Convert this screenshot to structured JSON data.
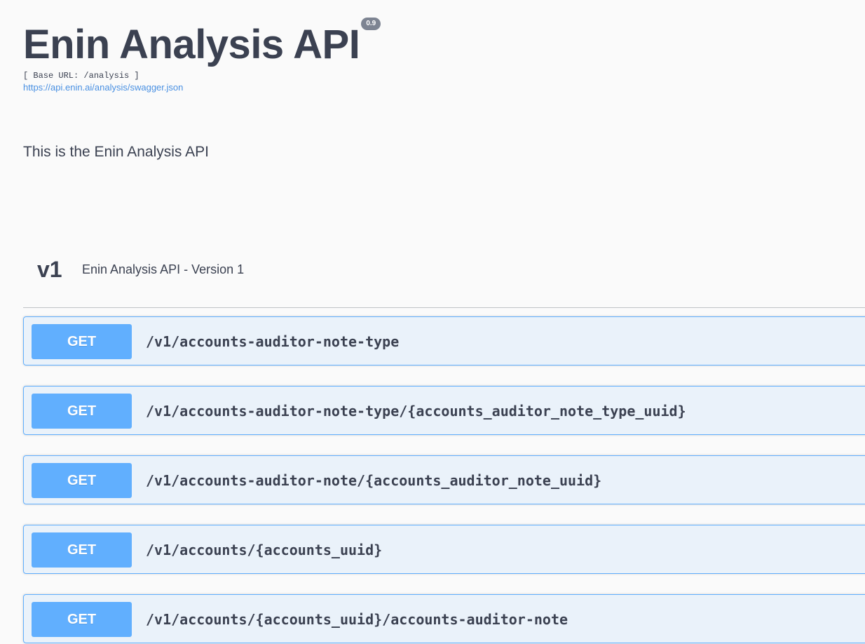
{
  "info": {
    "title": "Enin Analysis API",
    "version": "0.9",
    "base_url": "[ Base URL: /analysis ]",
    "spec_link": "https://api.enin.ai/analysis/swagger.json",
    "description": "This is the Enin Analysis API"
  },
  "tag": {
    "name": "v1",
    "description": "Enin Analysis API - Version 1"
  },
  "colors": {
    "get_method": "#61affe",
    "text": "#3b4151",
    "link": "#4990e2",
    "badge": "#7d8492"
  },
  "operations": [
    {
      "method": "GET",
      "path": "/v1/accounts-auditor-note-type"
    },
    {
      "method": "GET",
      "path": "/v1/accounts-auditor-note-type/{accounts_auditor_note_type_uuid}"
    },
    {
      "method": "GET",
      "path": "/v1/accounts-auditor-note/{accounts_auditor_note_uuid}"
    },
    {
      "method": "GET",
      "path": "/v1/accounts/{accounts_uuid}"
    },
    {
      "method": "GET",
      "path": "/v1/accounts/{accounts_uuid}/accounts-auditor-note"
    }
  ]
}
